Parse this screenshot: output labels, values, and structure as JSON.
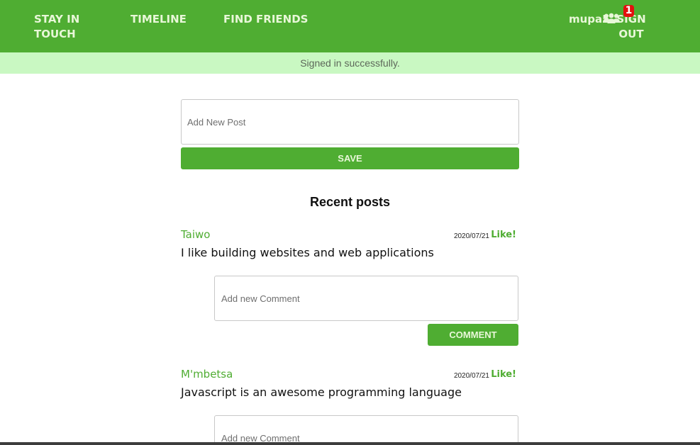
{
  "navbar": {
    "brand": "STAY IN TOUCH",
    "links": {
      "timeline": "TIMELINE",
      "find_friends": "FIND FRIENDS"
    },
    "username": "mupa5",
    "friend_requests_icon": "friends-icon",
    "notification_count": "1",
    "sign_out": "SIGN OUT"
  },
  "flash": {
    "notice": "Signed in successfully."
  },
  "new_post": {
    "placeholder": "Add New Post",
    "save_label": "SAVE"
  },
  "posts_section": {
    "title": "Recent posts"
  },
  "posts": [
    {
      "author": "Taiwo",
      "date": "2020/07/21",
      "like_label": "Like!",
      "content": "I like building websites and web applications",
      "comment_placeholder": "Add new Comment",
      "comment_label": "COMMENT"
    },
    {
      "author": "M'mbetsa",
      "date": "2020/07/21",
      "like_label": "Like!",
      "content": "Javascript is an awesome programming language",
      "comment_placeholder": "Add new Comment"
    }
  ],
  "colors": {
    "primary": "#4fad32",
    "nav_text": "#e8f7d8",
    "flash_bg": "#c9f8c2",
    "badge": "#e3100f"
  }
}
